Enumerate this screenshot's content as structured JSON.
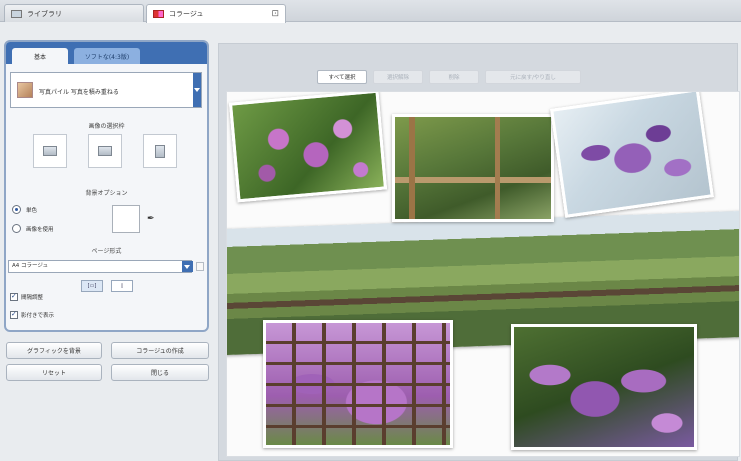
{
  "tabs": {
    "library": "ライブラリ",
    "collage": "コラージュ"
  },
  "panel": {
    "tab_main": "基本",
    "tab_sub": "ソフトな(4:3版)",
    "preset_label": "写真パイル 写真を積み重ねる",
    "orientation_title": "画像の選択枠",
    "background_title": "背景オプション",
    "radio_color": "単色",
    "radio_image": "画像を使用",
    "page_format_title": "ページ形式",
    "page_format_value": "A4 コラージュ",
    "orient_landscape": "[▭]",
    "orient_portrait": "▯",
    "check_spacing": "間隔調整",
    "check_shadow": "影付きで表示",
    "buttons": {
      "graphic_bg": "グラフィックを背景",
      "create_collage": "コラージュの作成",
      "reset": "リセット",
      "close": "閉じる"
    }
  },
  "toolbar": {
    "select_all": "すべて選択",
    "deselect": "選択解除",
    "delete": "削除",
    "restore": "元に戻す/やり直し"
  }
}
